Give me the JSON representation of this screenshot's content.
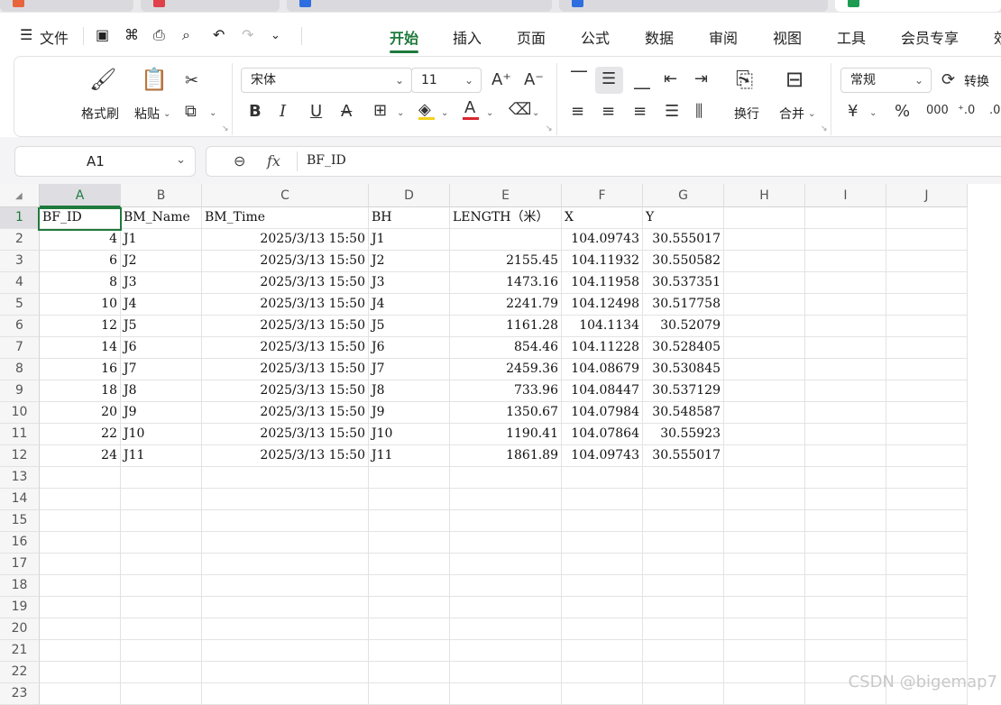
{
  "menu": {
    "file_label": "文件",
    "tabs": [
      "开始",
      "插入",
      "页面",
      "公式",
      "数据",
      "审阅",
      "视图",
      "工具",
      "会员专享",
      "效"
    ],
    "active_tab": "开始"
  },
  "ribbon": {
    "format_painter": "格式刷",
    "paste": "粘贴",
    "font_name": "宋体",
    "font_size": "11",
    "wrap_text": "换行",
    "merge": "合并",
    "number_format": "常规",
    "convert": "转换"
  },
  "formula_bar": {
    "name_box": "A1",
    "fx_symbol": "fx",
    "content": "BF_ID"
  },
  "sheet": {
    "columns": [
      "A",
      "B",
      "C",
      "D",
      "E",
      "F",
      "G",
      "H",
      "I",
      "J"
    ],
    "row_numbers": [
      "1",
      "2",
      "3",
      "4",
      "5",
      "6",
      "7",
      "8",
      "9",
      "10",
      "11",
      "12",
      "13",
      "14",
      "15",
      "16",
      "17",
      "18",
      "19",
      "20",
      "21",
      "22",
      "23"
    ],
    "headers": [
      "BF_ID",
      "BM_Name",
      "BM_Time",
      "BH",
      "LENGTH（米）",
      "X",
      "Y"
    ],
    "rows": [
      [
        "4",
        "J1",
        "2025/3/13 15:50",
        "J1",
        "",
        "104.09743",
        "30.555017"
      ],
      [
        "6",
        "J2",
        "2025/3/13 15:50",
        "J2",
        "2155.45",
        "104.11932",
        "30.550582"
      ],
      [
        "8",
        "J3",
        "2025/3/13 15:50",
        "J3",
        "1473.16",
        "104.11958",
        "30.537351"
      ],
      [
        "10",
        "J4",
        "2025/3/13 15:50",
        "J4",
        "2241.79",
        "104.12498",
        "30.517758"
      ],
      [
        "12",
        "J5",
        "2025/3/13 15:50",
        "J5",
        "1161.28",
        "104.1134",
        "30.52079"
      ],
      [
        "14",
        "J6",
        "2025/3/13 15:50",
        "J6",
        "854.46",
        "104.11228",
        "30.528405"
      ],
      [
        "16",
        "J7",
        "2025/3/13 15:50",
        "J7",
        "2459.36",
        "104.08679",
        "30.530845"
      ],
      [
        "18",
        "J8",
        "2025/3/13 15:50",
        "J8",
        "733.96",
        "104.08447",
        "30.537129"
      ],
      [
        "20",
        "J9",
        "2025/3/13 15:50",
        "J9",
        "1350.67",
        "104.07984",
        "30.548587"
      ],
      [
        "22",
        "J10",
        "2025/3/13 15:50",
        "J10",
        "1190.41",
        "104.07864",
        "30.55923"
      ],
      [
        "24",
        "J11",
        "2025/3/13 15:50",
        "J11",
        "1861.89",
        "104.09743",
        "30.555017"
      ]
    ]
  },
  "watermark": "CSDN @bigemap7",
  "colors": {
    "accent": "#1e7a3c"
  }
}
